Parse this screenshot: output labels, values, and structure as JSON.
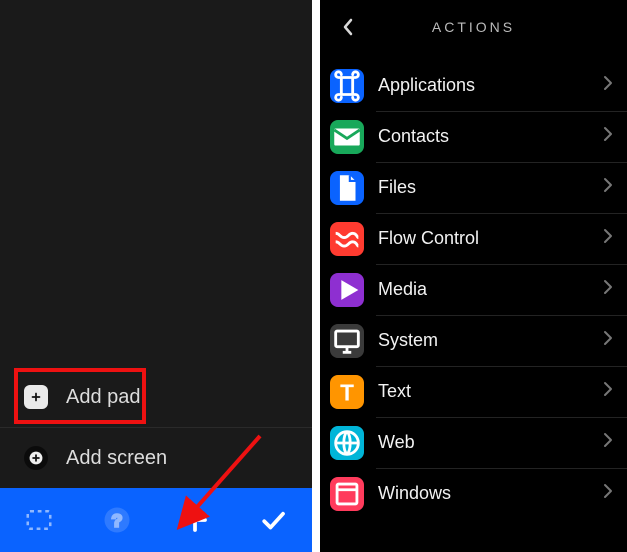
{
  "left": {
    "menu": [
      {
        "label": "Add pad",
        "icon": "plus-square"
      },
      {
        "label": "Add screen",
        "icon": "plus-circle"
      }
    ],
    "toolbar": [
      "select",
      "help",
      "add",
      "confirm"
    ]
  },
  "right": {
    "title": "ACTIONS",
    "items": [
      {
        "label": "Applications",
        "icon": "command",
        "color": "#0a63ff"
      },
      {
        "label": "Contacts",
        "icon": "mail",
        "color": "#18a85a"
      },
      {
        "label": "Files",
        "icon": "file",
        "color": "#0a63ff"
      },
      {
        "label": "Flow Control",
        "icon": "waves",
        "color": "#ff3b30"
      },
      {
        "label": "Media",
        "icon": "play",
        "color": "#8e2fd1"
      },
      {
        "label": "System",
        "icon": "monitor",
        "color": "#3a3a3a"
      },
      {
        "label": "Text",
        "icon": "text",
        "color": "#ff9500"
      },
      {
        "label": "Web",
        "icon": "globe",
        "color": "#00b5d8"
      },
      {
        "label": "Windows",
        "icon": "window",
        "color": "#ff3b5c"
      }
    ]
  },
  "annotations": {
    "highlight_index": 0
  }
}
